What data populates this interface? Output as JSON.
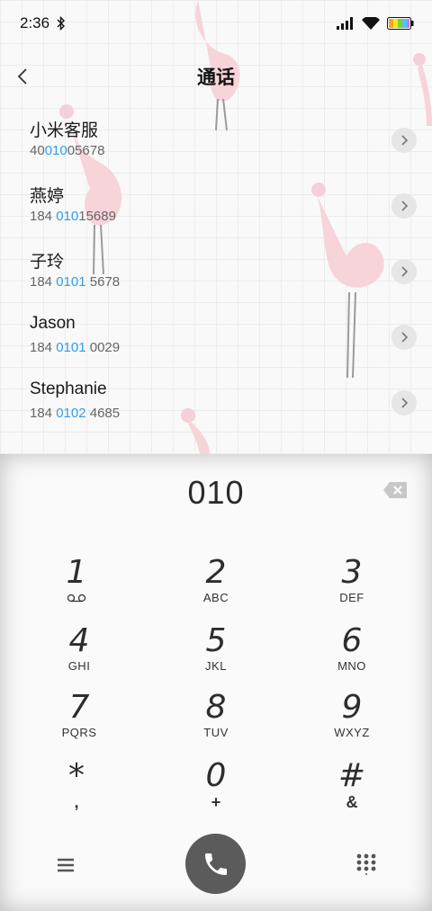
{
  "status_bar": {
    "time": "2:36"
  },
  "header": {
    "title": "通话"
  },
  "contacts": [
    {
      "name": "小米客服",
      "number_pre": "40",
      "number_hl": "010",
      "number_post": "05678"
    },
    {
      "name": "燕婷",
      "number_pre": "184 ",
      "number_hl": "010",
      "number_post": "15689"
    },
    {
      "name": "子玲",
      "number_pre": "184 ",
      "number_hl": "0101",
      "number_post": " 5678"
    },
    {
      "name": "Jason",
      "number_pre": "184 ",
      "number_hl": "0101",
      "number_post": " 0029"
    },
    {
      "name": "Stephanie",
      "number_pre": "184 ",
      "number_hl": "0102",
      "number_post": " 4685"
    }
  ],
  "dialer": {
    "input": "010",
    "keys": [
      {
        "digit": "1",
        "sub": ""
      },
      {
        "digit": "2",
        "sub": "ABC"
      },
      {
        "digit": "3",
        "sub": "DEF"
      },
      {
        "digit": "4",
        "sub": "GHI"
      },
      {
        "digit": "5",
        "sub": "JKL"
      },
      {
        "digit": "6",
        "sub": "MNO"
      },
      {
        "digit": "7",
        "sub": "PQRS"
      },
      {
        "digit": "8",
        "sub": "TUV"
      },
      {
        "digit": "9",
        "sub": "WXYZ"
      },
      {
        "digit": "*",
        "sub": ","
      },
      {
        "digit": "0",
        "sub": "+"
      },
      {
        "digit": "#",
        "sub": "&"
      }
    ]
  },
  "colors": {
    "accent": "#2f9ee8",
    "call_button": "#5b5b5b"
  },
  "icons": {
    "status": [
      "bluetooth-icon",
      "signal-icon",
      "wifi-icon",
      "battery-icon"
    ],
    "header": "back-chevron-icon",
    "row": "chevron-right-icon",
    "dialer": [
      "backspace-icon",
      "voicemail-icon",
      "menu-icon",
      "phone-icon",
      "keypad-icon"
    ]
  }
}
